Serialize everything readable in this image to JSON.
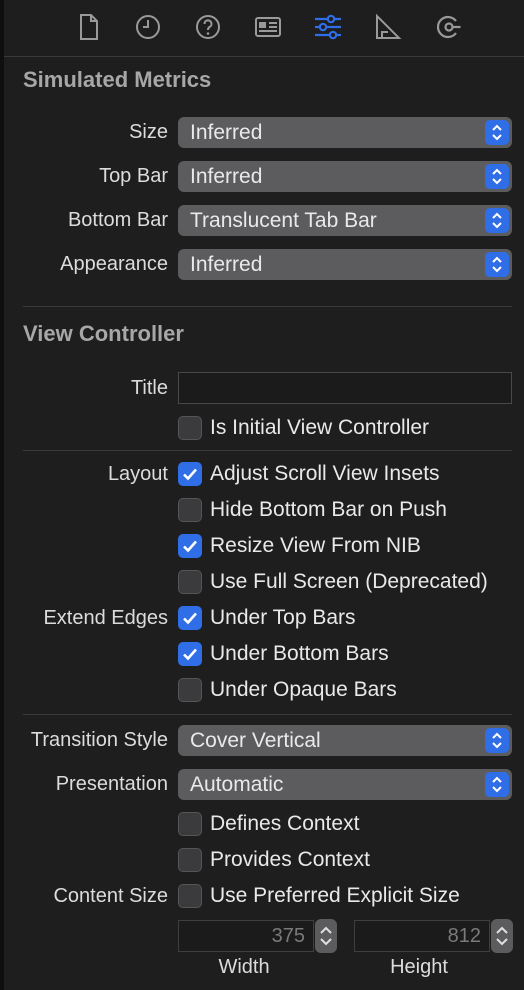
{
  "toolbar": {
    "icons": [
      "file-icon",
      "clock-icon",
      "help-icon",
      "identity-icon",
      "sliders-icon",
      "ruler-icon",
      "connections-icon"
    ],
    "accent": "#2f6ee6"
  },
  "simulated_metrics": {
    "title": "Simulated Metrics",
    "rows": [
      {
        "label": "Size",
        "value": "Inferred"
      },
      {
        "label": "Top Bar",
        "value": "Inferred"
      },
      {
        "label": "Bottom Bar",
        "value": "Translucent Tab Bar"
      },
      {
        "label": "Appearance",
        "value": "Inferred"
      }
    ]
  },
  "view_controller": {
    "title": "View Controller",
    "title_label": "Title",
    "title_value": "",
    "initial": {
      "label": "Is Initial View Controller",
      "checked": false
    },
    "layout_label": "Layout",
    "layout": [
      {
        "label": "Adjust Scroll View Insets",
        "checked": true
      },
      {
        "label": "Hide Bottom Bar on Push",
        "checked": false
      },
      {
        "label": "Resize View From NIB",
        "checked": true
      },
      {
        "label": "Use Full Screen (Deprecated)",
        "checked": false
      }
    ],
    "extend_edges_label": "Extend Edges",
    "extend_edges": [
      {
        "label": "Under Top Bars",
        "checked": true
      },
      {
        "label": "Under Bottom Bars",
        "checked": true
      },
      {
        "label": "Under Opaque Bars",
        "checked": false
      }
    ],
    "transition_label": "Transition Style",
    "transition_value": "Cover Vertical",
    "presentation_label": "Presentation",
    "presentation_value": "Automatic",
    "context": [
      {
        "label": "Defines Context",
        "checked": false
      },
      {
        "label": "Provides Context",
        "checked": false
      }
    ],
    "content_size_label": "Content Size",
    "content_size": {
      "label": "Use Preferred Explicit Size",
      "checked": false
    },
    "width_value": "375",
    "height_value": "812",
    "width_label": "Width",
    "height_label": "Height"
  }
}
